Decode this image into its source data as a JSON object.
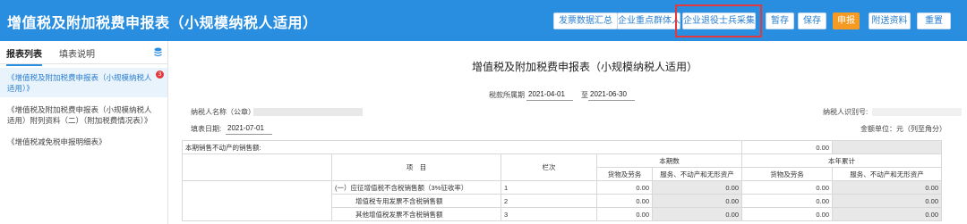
{
  "header": {
    "title": "增值税及附加税费申报表（小规模纳税人适用）",
    "buttons": [
      "发票数据汇总",
      "企业重点群体人员采集",
      "企业退役士兵采集",
      "暂存",
      "保存",
      "申报",
      "附送资料",
      "重置"
    ]
  },
  "sidebar": {
    "tabs": [
      "报表列表",
      "填表说明"
    ],
    "items": [
      {
        "label": "《增值税及附加税费申报表（小规模纳税人适用）》",
        "badge": "3"
      },
      {
        "label": "《增值税及附加税费申报表（小规模纳税人适用）附列资料（二）（附加税费情况表）》"
      },
      {
        "label": "《增值税减免税申报明细表》"
      }
    ]
  },
  "form": {
    "title": "增值税及附加税费申报表（小规模纳税人适用）",
    "period_label": "税款所属期",
    "period_start": "2021-04-01",
    "period_to": "至",
    "period_end": "2021-06-30",
    "taxpayer_name_label": "纳税人名称（公章）:",
    "taxpayer_id_label": "纳税人识别号:",
    "fill_date_label": "填表日期:",
    "fill_date": "2021-07-01",
    "unit_label": "金额单位：元（列至角分）",
    "table": {
      "real_estate_label": "本期销售不动产的销售额:",
      "real_estate_value": "0.00",
      "item_header": "项　目",
      "col_header": "栏次",
      "current_header": "本期数",
      "ytd_header": "本年累计",
      "goods_header": "货物及劳务",
      "services_header": "服务、不动产和无形资产",
      "rows": [
        {
          "item": "(一）应征增值税不含税销售额（3%征收率）",
          "col": "1",
          "v1": "0.00",
          "v2": "0.00",
          "v3": "0.00",
          "v4": "0.00"
        },
        {
          "item": "增值税专用发票不含税销售额",
          "col": "2",
          "v1": "0.00",
          "v2": "0.00",
          "v3": "0.00",
          "v4": "0.00"
        },
        {
          "item": "其他增值税发票不含税销售额",
          "col": "3",
          "v1": "0.00",
          "v2": "0.00",
          "v3": "0.00",
          "v4": "0.00"
        }
      ]
    }
  }
}
